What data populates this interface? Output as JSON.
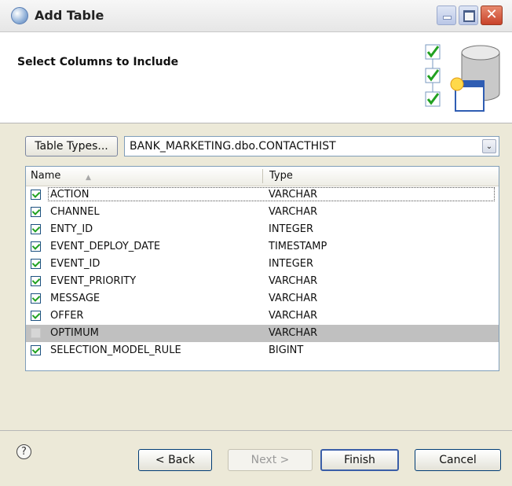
{
  "window": {
    "title": "Add Table",
    "close_glyph": "✕"
  },
  "header": {
    "title": "Select Columns to Include"
  },
  "toolbar": {
    "table_types_label": "Table Types...",
    "table_selected": "BANK_MARKETING.dbo.CONTACTHIST",
    "dropdown_glyph": "⌄"
  },
  "table": {
    "columns": [
      "Name",
      "Type"
    ],
    "sort_glyph": "▲",
    "rows": [
      {
        "name": "ACTION",
        "type": "VARCHAR",
        "checked": true
      },
      {
        "name": "CHANNEL",
        "type": "VARCHAR",
        "checked": true
      },
      {
        "name": "ENTY_ID",
        "type": "INTEGER",
        "checked": true
      },
      {
        "name": "EVENT_DEPLOY_DATE",
        "type": "TIMESTAMP",
        "checked": true
      },
      {
        "name": "EVENT_ID",
        "type": "INTEGER",
        "checked": true
      },
      {
        "name": "EVENT_PRIORITY",
        "type": "VARCHAR",
        "checked": true
      },
      {
        "name": "MESSAGE",
        "type": "VARCHAR",
        "checked": true
      },
      {
        "name": "OFFER",
        "type": "VARCHAR",
        "checked": true
      },
      {
        "name": "OPTIMUM",
        "type": "VARCHAR",
        "checked": false
      },
      {
        "name": "SELECTION_MODEL_RULE",
        "type": "BIGINT",
        "checked": true
      }
    ]
  },
  "footer": {
    "help_glyph": "?",
    "back_label": "< Back",
    "next_label": "Next >",
    "finish_label": "Finish",
    "cancel_label": "Cancel"
  },
  "colors": {
    "dialog_bg": "#ECE9D8",
    "header_bg": "#FFFFFF",
    "selected_row": "#C0C0C0",
    "check_green": "#21A121",
    "close_red": "#C8422A"
  },
  "icons": [
    "window-app-icon",
    "minimize-icon",
    "maximize-icon",
    "close-icon",
    "database-banner-icon",
    "dropdown-arrow-icon",
    "sort-ascending-icon",
    "checkbox-icon",
    "help-icon"
  ]
}
